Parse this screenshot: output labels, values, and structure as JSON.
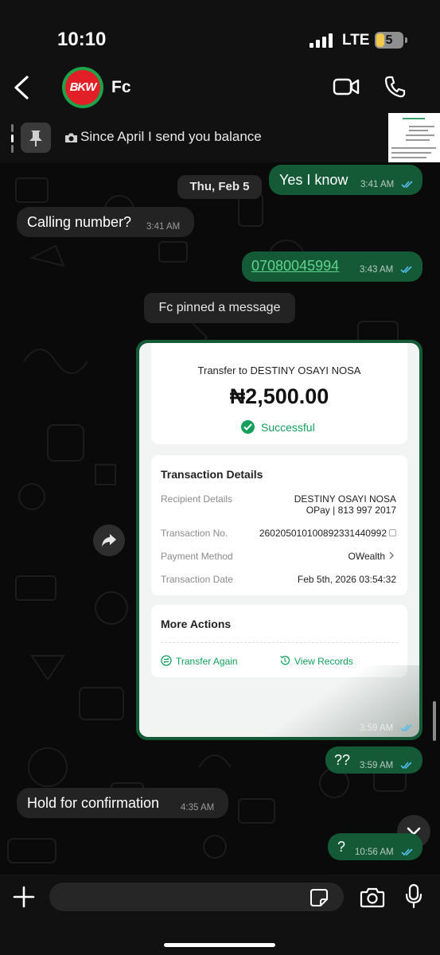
{
  "status_bar": {
    "time": "10:10",
    "network": "LTE",
    "battery": "5"
  },
  "header": {
    "contact_name": "Fc",
    "avatar_text": "BKW"
  },
  "pinned": {
    "text": "Since April I send you balance"
  },
  "chat": {
    "date_chip": "Thu, Feb 5",
    "system_message": "Fc pinned a message",
    "messages": [
      {
        "direction": "out",
        "text": "Yes I know",
        "time": "3:41 AM"
      },
      {
        "direction": "in",
        "text": "Calling number?",
        "time": "3:41 AM"
      },
      {
        "direction": "out",
        "text": "07080045994",
        "time": "3:43 AM"
      },
      {
        "direction": "out",
        "text": "",
        "time": "3:59 AM"
      },
      {
        "direction": "out",
        "text": "??",
        "time": "3:59 AM"
      },
      {
        "direction": "in",
        "text": "Hold for confirmation",
        "time": "4:35 AM"
      },
      {
        "direction": "out",
        "text": "?",
        "time": "10:56 AM"
      }
    ]
  },
  "receipt": {
    "title": "Transfer to DESTINY OSAYI NOSA",
    "amount": "₦2,500.00",
    "status": "Successful",
    "details_title": "Transaction Details",
    "rows": [
      {
        "label": "Recipient Details",
        "value": "DESTINY OSAYI NOSA",
        "value2": "OPay | 813 997 2017"
      },
      {
        "label": "Transaction No.",
        "value": "260205010100892331440992"
      },
      {
        "label": "Payment Method",
        "value": "OWealth"
      },
      {
        "label": "Transaction Date",
        "value": "Feb 5th, 2026 03:54:32"
      }
    ],
    "more_actions_title": "More Actions",
    "actions": [
      "Transfer Again",
      "View Records"
    ]
  },
  "composer": {
    "placeholder": ""
  },
  "colors": {
    "outgoing_bubble": "#145a37",
    "incoming_bubble": "#232323",
    "accent_green": "#12a05c",
    "read_ticks": "#53bdeb"
  }
}
